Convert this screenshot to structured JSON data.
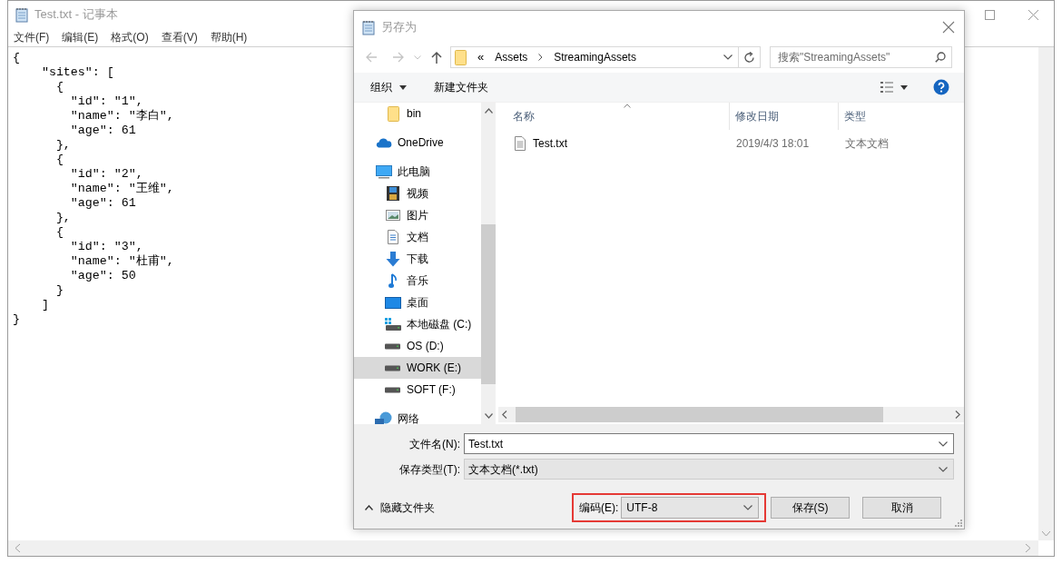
{
  "notepad": {
    "title": "Test.txt - 记事本",
    "menu": [
      "文件(F)",
      "编辑(E)",
      "格式(O)",
      "查看(V)",
      "帮助(H)"
    ],
    "text_lines": [
      "{",
      "    \"sites\": [",
      "      {",
      "        \"id\": \"1\",",
      "        \"name\": \"李白\",",
      "        \"age\": 61",
      "      },",
      "      {",
      "        \"id\": \"2\",",
      "        \"name\": \"王维\",",
      "        \"age\": 61",
      "      },",
      "      {",
      "        \"id\": \"3\",",
      "        \"name\": \"杜甫\",",
      "        \"age\": 50",
      "      }",
      "    ]",
      "}"
    ]
  },
  "dialog": {
    "title": "另存为",
    "address": {
      "overflow": "«",
      "path": [
        "Assets",
        "StreamingAssets"
      ]
    },
    "search": {
      "placeholder": "搜索\"StreamingAssets\""
    },
    "toolbar": [
      "组织",
      "新建文件夹"
    ],
    "nav_tree": [
      {
        "label": "bin",
        "kind": "folder",
        "selected": false
      },
      {
        "label": "OneDrive",
        "kind": "cloud",
        "selected": false
      },
      {
        "label": "此电脑",
        "kind": "pc",
        "selected": false,
        "children": [
          {
            "label": "视频",
            "kind": "video",
            "selected": false
          },
          {
            "label": "图片",
            "kind": "picture",
            "selected": false
          },
          {
            "label": "文档",
            "kind": "document",
            "selected": false
          },
          {
            "label": "下载",
            "kind": "download",
            "selected": false
          },
          {
            "label": "音乐",
            "kind": "music",
            "selected": false
          },
          {
            "label": "桌面",
            "kind": "desktop",
            "selected": false
          },
          {
            "label": "本地磁盘 (C:)",
            "kind": "system-drive",
            "selected": false
          },
          {
            "label": "OS (D:)",
            "kind": "drive",
            "selected": false
          },
          {
            "label": "WORK (E:)",
            "kind": "drive",
            "selected": true
          },
          {
            "label": "SOFT (F:)",
            "kind": "drive",
            "selected": false
          }
        ]
      },
      {
        "label": "网络",
        "kind": "network",
        "selected": false
      }
    ],
    "file_list": {
      "columns": [
        "名称",
        "修改日期",
        "类型"
      ],
      "rows": [
        {
          "name": "Test.txt",
          "modified": "2019/4/3 18:01",
          "type": "文本文档"
        }
      ]
    },
    "file_name": {
      "label": "文件名(N):",
      "value": "Test.txt"
    },
    "save_type": {
      "label": "保存类型(T):",
      "value": "文本文档(*.txt)"
    },
    "hide_folders": "隐藏文件夹",
    "encoding": {
      "label": "编码(E):",
      "value": "UTF-8",
      "highlighted": true
    },
    "buttons": [
      "保存(S)",
      "取消"
    ]
  }
}
